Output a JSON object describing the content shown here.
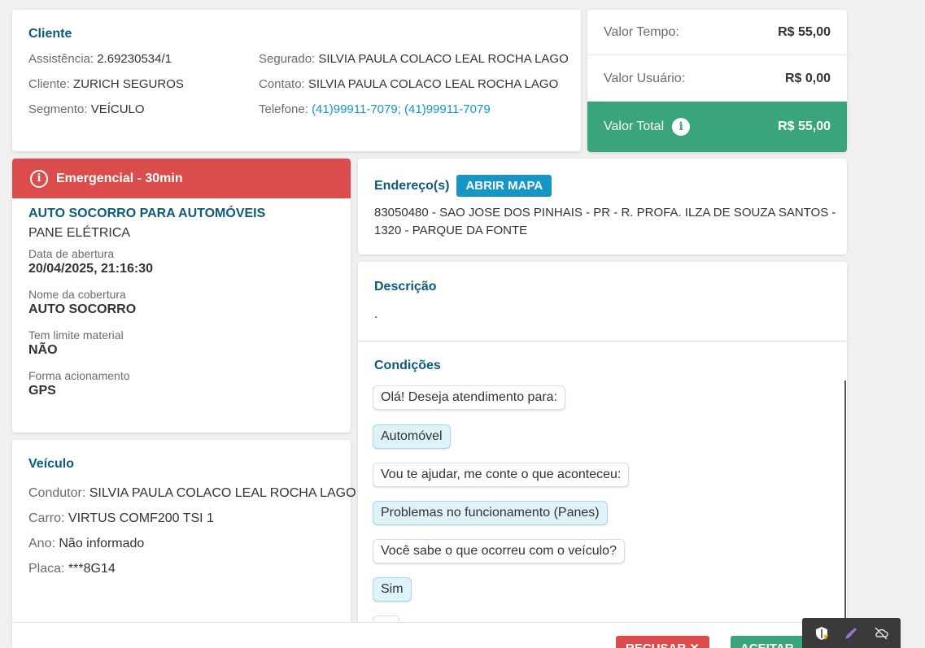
{
  "client": {
    "title": "Cliente",
    "left": [
      {
        "label": "Assistência:",
        "value": "2.69230534/1"
      },
      {
        "label": "Cliente:",
        "value": "ZURICH SEGUROS"
      },
      {
        "label": "Segmento:",
        "value": "VEÍCULO"
      }
    ],
    "right": [
      {
        "label": "Segurado:",
        "value": "SILVIA PAULA COLACO LEAL ROCHA LAGO"
      },
      {
        "label": "Contato:",
        "value": "SILVIA PAULA COLACO LEAL ROCHA LAGO"
      },
      {
        "label": "Telefone:",
        "value": "(41)99911-7079; (41)99911-7079"
      }
    ]
  },
  "values": {
    "tempo_label": "Valor Tempo:",
    "tempo_value": "R$ 55,00",
    "usuario_label": "Valor Usuário:",
    "usuario_value": "R$ 0,00",
    "total_label": "Valor Total",
    "total_value": "R$ 55,00",
    "info_icon": "info-icon",
    "total_color": "#3aa57b"
  },
  "service": {
    "priority": "Emergencial - 30min",
    "priority_color": "#dc4c4c",
    "type": "AUTO SOCORRO PARA AUTOMÓVEIS",
    "subtype": "PANE ELÉTRICA",
    "fields": [
      {
        "label": "Data de abertura",
        "value": "20/04/2025, 21:16:30"
      },
      {
        "label": "Nome da cobertura",
        "value": "AUTO SOCORRO"
      },
      {
        "label": "Tem limite material",
        "value": "NÃO"
      },
      {
        "label": "Forma acionamento",
        "value": "GPS"
      }
    ]
  },
  "vehicle": {
    "title": "Veículo",
    "rows": [
      {
        "label": "Condutor:",
        "value": "SILVIA PAULA COLACO LEAL ROCHA LAGO"
      },
      {
        "label": "Carro:",
        "value": "VIRTUS COMF200 TSI 1"
      },
      {
        "label": "Ano:",
        "value": "Não informado"
      },
      {
        "label": "Placa:",
        "value": "***8G14"
      }
    ]
  },
  "address": {
    "title": "Endereço(s)",
    "map_button": "ABRIR MAPA",
    "text": "83050480 - SAO JOSE DOS PINHAIS - PR - R. PROFA. ILZA DE SOUZA SANTOS - 1320 - PARQUE DA FONTE"
  },
  "description": {
    "title": "Descrição",
    "text": "."
  },
  "conditions": {
    "title": "Condições",
    "messages": [
      {
        "from": "bot",
        "text": "Olá! Deseja atendimento para:"
      },
      {
        "from": "user",
        "text": "Automóvel"
      },
      {
        "from": "bot",
        "text": "Vou te ajudar, me conte o que aconteceu:"
      },
      {
        "from": "user",
        "text": "Problemas no funcionamento (Panes)"
      },
      {
        "from": "bot",
        "text": "Você sabe o que ocorreu com o veículo?"
      },
      {
        "from": "user",
        "text": "Sim"
      },
      {
        "from": "bot",
        "text": "..."
      }
    ]
  },
  "footer": {
    "refuse_label": "RECUSAR",
    "accept_label": "ACEITAR"
  },
  "tray": {
    "icons": [
      "shield-warning-icon",
      "pen-icon",
      "cloud-off-icon"
    ]
  }
}
